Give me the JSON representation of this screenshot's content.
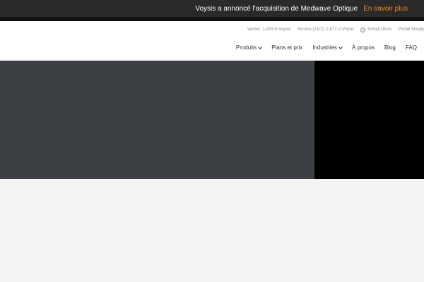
{
  "announcement": {
    "message": "Voysis a annoncé l'acquisition de Medwave Optique",
    "link": "En savoir plus",
    "link_color": "#f0891e"
  },
  "utility_bar": {
    "sales": "Ventes: 1-833-9-Voysis",
    "service": "Service (24/7): 1-877-2-Voysis",
    "portal_ubois": "Portail Ubois",
    "portal_simply": "Portail Simply",
    "portal_icon": "user-circle-icon"
  },
  "nav": {
    "items": [
      {
        "label": "Produits",
        "has_dropdown": true
      },
      {
        "label": "Plans et prix",
        "has_dropdown": false
      },
      {
        "label": "Industries",
        "has_dropdown": true
      },
      {
        "label": "À propos",
        "has_dropdown": false
      },
      {
        "label": "Blog",
        "has_dropdown": false
      },
      {
        "label": "FAQ",
        "has_dropdown": false
      }
    ]
  },
  "colors": {
    "announcement_bg": "#2a2a2a",
    "hero_left": "#3c3f44",
    "hero_right": "#000000",
    "page_bg": "#f3f3f3"
  }
}
